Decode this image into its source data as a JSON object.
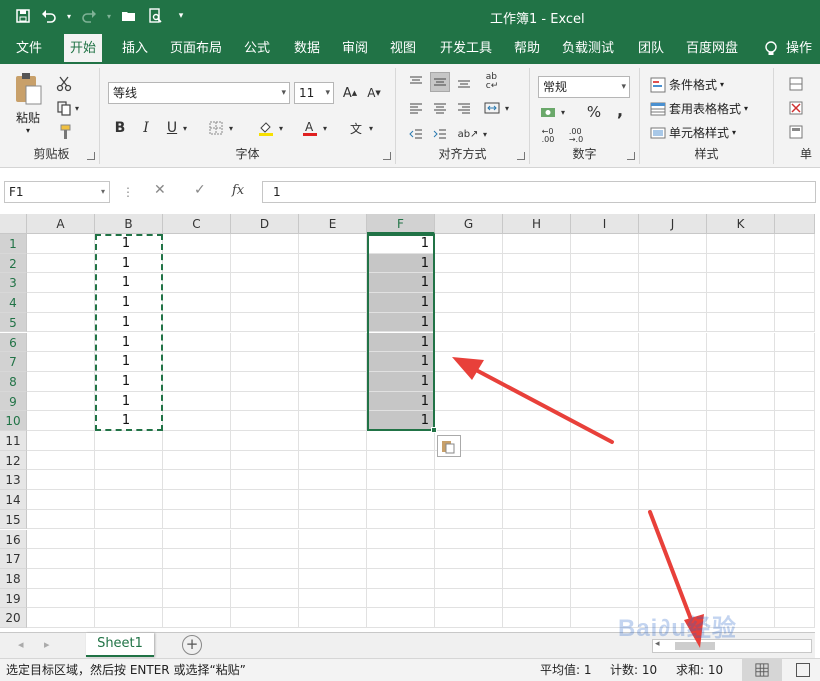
{
  "window": {
    "title": "工作簿1  -  Excel"
  },
  "tabs": [
    "文件",
    "开始",
    "插入",
    "页面布局",
    "公式",
    "数据",
    "审阅",
    "视图",
    "开发工具",
    "帮助",
    "负载测试",
    "团队",
    "百度网盘",
    "操作"
  ],
  "ribbon": {
    "clipboard": {
      "label": "剪贴板",
      "paste_label": "粘贴"
    },
    "font": {
      "label": "字体",
      "font_name": "等线",
      "font_size": "11",
      "bold": "B",
      "italic": "I",
      "underline": "U",
      "grow": "A",
      "shrink": "A",
      "phonetic": "文"
    },
    "alignment": {
      "label": "对齐方式"
    },
    "number": {
      "label": "数字",
      "format": "常规",
      "percent": "%",
      "comma": ","
    },
    "styles": {
      "label": "样式",
      "conditional": "条件格式",
      "table_format": "套用表格格式",
      "cell_styles": "单元格样式"
    },
    "cells": {
      "label": "单"
    }
  },
  "formula_bar": {
    "name_box": "F1",
    "cancel": "✕",
    "enter": "✓",
    "fx": "fx",
    "value": "1"
  },
  "grid": {
    "columns": [
      "A",
      "B",
      "C",
      "D",
      "E",
      "F",
      "G",
      "H",
      "I",
      "J",
      "K"
    ],
    "rows": [
      "1",
      "2",
      "3",
      "4",
      "5",
      "6",
      "7",
      "8",
      "9",
      "10",
      "11",
      "12",
      "13",
      "14",
      "15",
      "16",
      "17",
      "18",
      "19",
      "20"
    ],
    "column_b_values": [
      "1",
      "1",
      "1",
      "1",
      "1",
      "1",
      "1",
      "1",
      "1",
      "1"
    ],
    "column_f_values": [
      "1",
      "1",
      "1",
      "1",
      "1",
      "1",
      "1",
      "1",
      "1",
      "1"
    ]
  },
  "sheet_tabs": {
    "sheet1": "Sheet1",
    "add": "+"
  },
  "status": {
    "message": "选定目标区域，然后按 ENTER 或选择“粘贴”",
    "average": "平均值: 1",
    "count": "计数: 10",
    "sum": "求和: 10"
  },
  "colors": {
    "accent": "#217346",
    "arrow": "#e8403a",
    "selection_fill": "#c6c6c6"
  }
}
